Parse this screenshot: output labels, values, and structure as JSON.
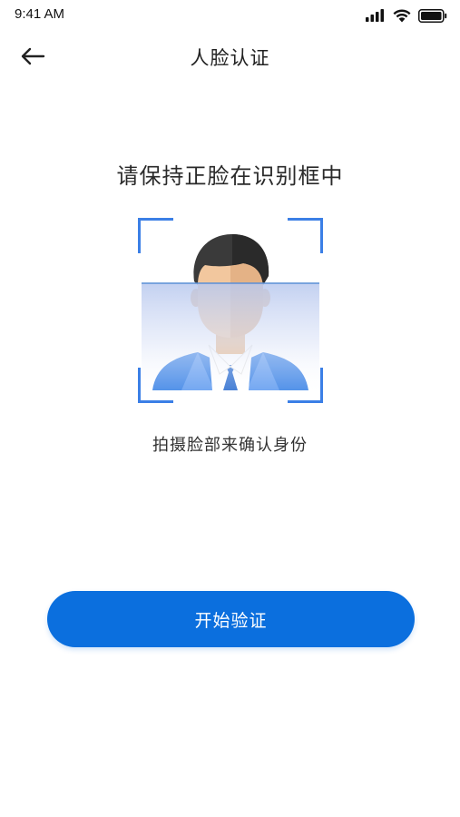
{
  "status_bar": {
    "time": "9:41 AM",
    "icons": [
      "signal-icon",
      "wifi-icon",
      "battery-icon"
    ]
  },
  "header": {
    "back_icon": "arrow-left-icon",
    "title": "人脸认证"
  },
  "main": {
    "instruction": "请保持正脸在识别框中",
    "caption": "拍摄脸部来确认身份"
  },
  "actions": {
    "start_label": "开始验证"
  },
  "colors": {
    "accent": "#0b6fde",
    "frame": "#3b7fe6",
    "scan_line": "#5b8fd6",
    "suit": "#3d84e6"
  }
}
